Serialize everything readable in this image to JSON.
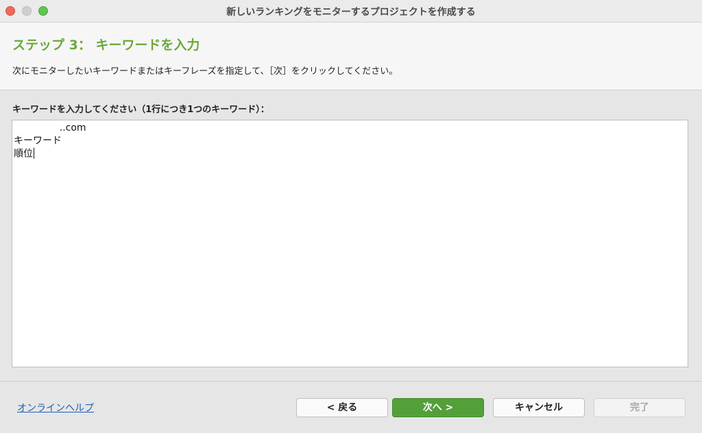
{
  "window": {
    "title": "新しいランキングをモニターするプロジェクトを作成する"
  },
  "header": {
    "step_title": "ステップ 3： キーワードを入力",
    "description": "次にモニターしたいキーワードまたはキーフレーズを指定して、［次］をクリックしてください。"
  },
  "keywords": {
    "label": "キーワードを入力してください（1行につき1つのキーワード）：",
    "lines": [
      "               ..com",
      "キーワード",
      "順位"
    ]
  },
  "footer": {
    "help_link": "オンラインヘルプ",
    "back_label": "< 戻る",
    "next_label": "次へ >",
    "cancel_label": "キャンセル",
    "finish_label": "完了"
  },
  "colors": {
    "accent_green": "#6aa93a",
    "next_button": "#53a038",
    "link_blue": "#1a5fb4"
  }
}
